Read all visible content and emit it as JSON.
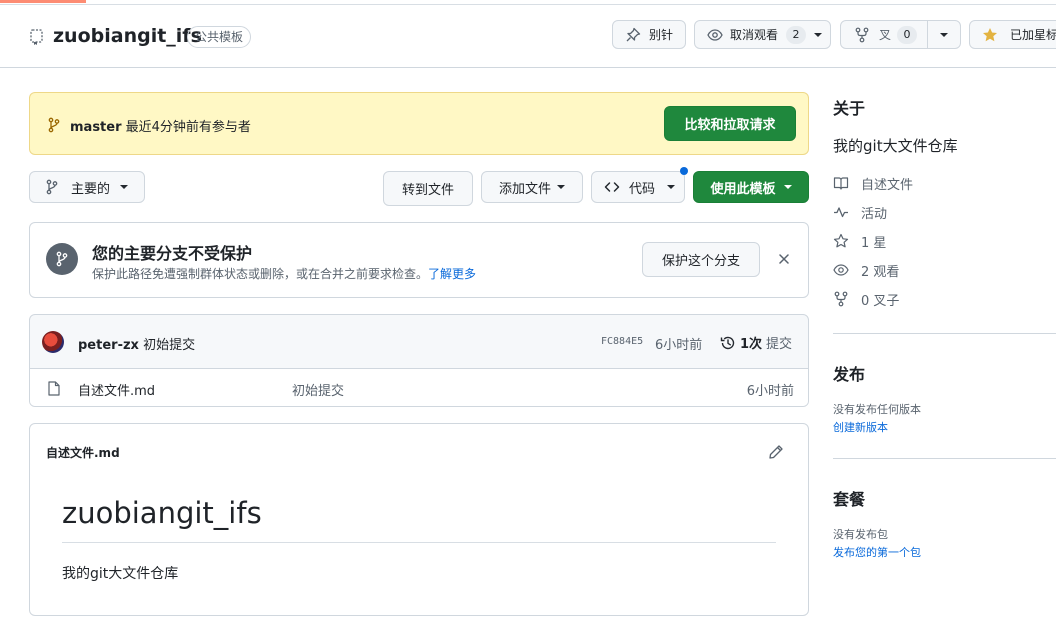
{
  "header": {
    "repo_name": "zuobiangit_ifs",
    "visibility": "公共模板",
    "pin_label": "别针",
    "watch_label": "取消观看",
    "watch_count": "2",
    "fork_label": "叉",
    "fork_count": "0",
    "star_label": "已加星标"
  },
  "banner": {
    "branch": "master",
    "text": "最近4分钟前有参与者",
    "compare_label": "比较和拉取请求"
  },
  "toolbar": {
    "branch_label": "主要的",
    "goto_file_label": "转到文件",
    "add_file_label": "添加文件",
    "code_label": "代码",
    "use_template_label": "使用此模板"
  },
  "protection": {
    "title": "您的主要分支不受保护",
    "description": "保护此路径免遭强制群体状态或删除，或在合并之前要求检查。",
    "learn_more": "了解更多",
    "protect_button": "保护这个分支"
  },
  "commit": {
    "author": "peter-zx",
    "message": "初始提交",
    "hash": "FC884E5",
    "time": "6小时前",
    "count": "1次",
    "count_label": "提交"
  },
  "files": [
    {
      "name": "自述文件.md",
      "message": "初始提交",
      "time": "6小时前"
    }
  ],
  "readme": {
    "label": "自述文件.md",
    "heading": "zuobiangit_ifs",
    "body": "我的git大文件仓库"
  },
  "sidebar": {
    "about_title": "关于",
    "description": "我的git大文件仓库",
    "items": [
      {
        "icon": "book-icon",
        "label": "自述文件"
      },
      {
        "icon": "pulse-icon",
        "label": "活动"
      },
      {
        "icon": "star-icon",
        "label": "1 星"
      },
      {
        "icon": "eye-icon",
        "label": "2 观看"
      },
      {
        "icon": "fork-icon",
        "label": "0 叉子"
      }
    ],
    "releases_title": "发布",
    "releases_none": "没有发布任何版本",
    "releases_link": "创建新版本",
    "packages_title": "套餐",
    "packages_none": "没有发布包",
    "packages_link": "发布您的第一个包"
  },
  "colors": {
    "accent_green": "#1f883d",
    "banner_yellow": "#fff8c5",
    "link_blue": "#0969da",
    "star_yellow": "#e3b341"
  }
}
